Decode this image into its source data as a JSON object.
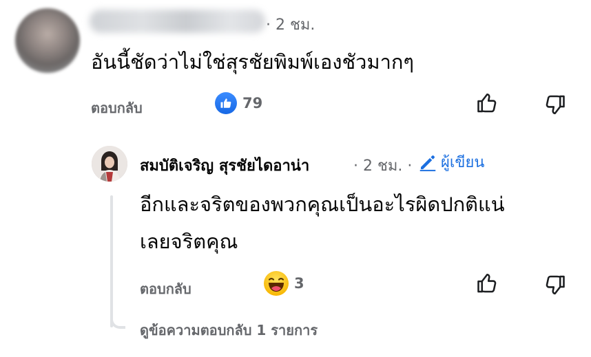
{
  "comment": {
    "author_obscured": true,
    "time": "· 2 ชม.",
    "text": "อันนี้ชัดว่าไม่ใช่สุรชัยพิมพ์เองชัวมากๆ",
    "reply_label": "ตอบกลับ",
    "reaction": {
      "icon": "like-icon",
      "count": "79"
    }
  },
  "reply": {
    "author": "สมบัติเจริญ สุรชัยไดอาน่า",
    "time": "· 2 ชม. ·",
    "author_badge": "ผู้เขียน",
    "text_line1": "อีกและจริตของพวกคุณเป็นอะไรผิดปกติแน่",
    "text_line2": "เลยจริตคุณ",
    "reply_label": "ตอบกลับ",
    "reaction": {
      "icon": "haha-icon",
      "count": "3"
    }
  },
  "view_replies": "ดูข้อความตอบกลับ 1 รายการ",
  "colors": {
    "accent": "#1b6fe0",
    "meta": "#65676b",
    "text": "#050505"
  }
}
